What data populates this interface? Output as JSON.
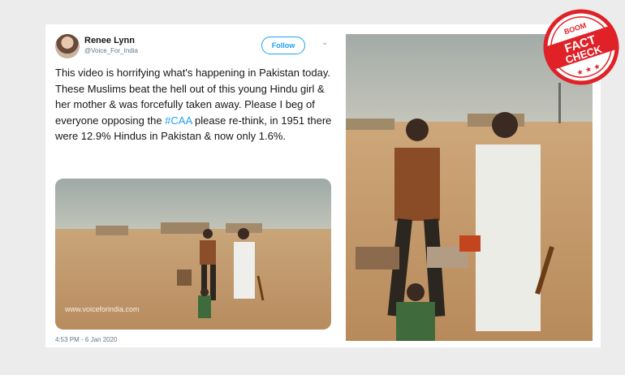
{
  "tweet": {
    "user_name": "Renee Lynn",
    "user_handle": "@Voice_For_India",
    "follow_label": "Follow",
    "text_before_hashtag": "This video is horrifying what's happening in Pakistan today. These Muslims beat the hell out of this young Hindu girl & her mother & was forcefully taken away. Please I beg of everyone opposing the ",
    "hashtag": "#CAA",
    "text_after_hashtag": " please re-think, in 1951 there were 12.9% Hindus in Pakistan & now only 1.6%.",
    "timestamp": "4:53 PM - 6 Jan 2020",
    "video_watermark": "www.voiceforindia.com"
  },
  "stamp": {
    "top_text": "BOOM",
    "line1": "FACT",
    "line2": "CHECK",
    "color": "#e02127"
  },
  "icons": {
    "menu": "chevron-down-icon"
  },
  "colors": {
    "accent": "#1da1f2",
    "text": "#14171a",
    "secondary": "#657786"
  }
}
